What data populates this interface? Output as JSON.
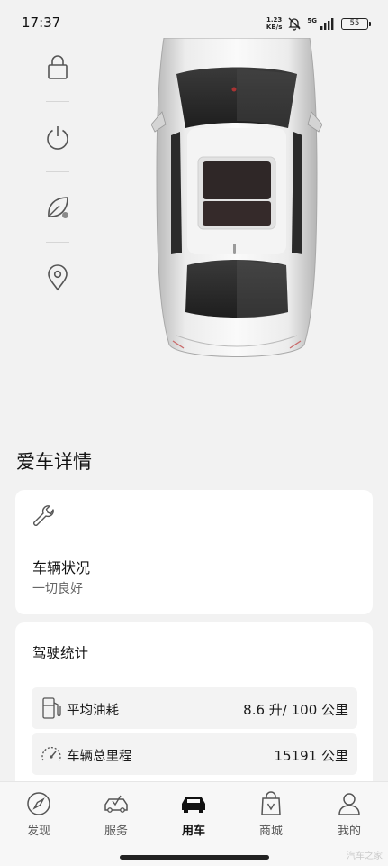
{
  "status_bar": {
    "time": "17:37",
    "net_speed_value": "1.23",
    "net_speed_unit": "KB/s",
    "network": "5G",
    "battery": "55",
    "icons": [
      "mute-bell-icon",
      "signal-icon",
      "battery-icon"
    ]
  },
  "controls": [
    {
      "name": "lock",
      "icon": "lock-icon"
    },
    {
      "name": "power",
      "icon": "power-icon"
    },
    {
      "name": "eco",
      "icon": "leaf-icon"
    },
    {
      "name": "location",
      "icon": "location-pin-icon"
    }
  ],
  "section_title": "爱车详情",
  "vehicle_status": {
    "icon": "wrench-icon",
    "title": "车辆状况",
    "subtitle": "一切良好"
  },
  "driving_stats": {
    "title": "驾驶统计",
    "rows": [
      {
        "icon": "fuel-pump-icon",
        "label": "平均油耗",
        "value": "8.6 升/ 100 公里"
      },
      {
        "icon": "odometer-icon",
        "label": "车辆总里程",
        "value": "15191 公里"
      }
    ]
  },
  "bottom_nav": {
    "items": [
      {
        "label": "发现",
        "icon": "compass-icon",
        "active": false
      },
      {
        "label": "服务",
        "icon": "car-service-icon",
        "active": false
      },
      {
        "label": "用车",
        "icon": "car-icon",
        "active": true
      },
      {
        "label": "商城",
        "icon": "shopping-bag-icon",
        "active": false
      },
      {
        "label": "我的",
        "icon": "person-icon",
        "active": false
      }
    ]
  },
  "watermark": "汽车之家",
  "colors": {
    "background": "#f2f2f2",
    "card": "#ffffff",
    "stat_row": "#f3f3f3",
    "text": "#1a1a1a",
    "muted": "#666666"
  }
}
